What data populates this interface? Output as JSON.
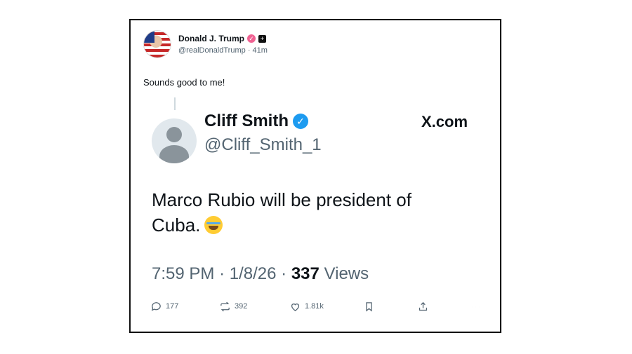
{
  "post": {
    "display_name": "Donald J. Trump",
    "handle": "@realDonaldTrump",
    "time": "41m",
    "text": "Sounds good to me!"
  },
  "quoted": {
    "display_name": "Cliff Smith",
    "handle": "@Cliff_Smith_1",
    "source": "X.com",
    "text": "Marco Rubio will be president of Cuba.",
    "time": "7:59 PM",
    "date": "1/8/26",
    "views_count": "337",
    "views_label": "Views"
  },
  "actions": {
    "replies": "177",
    "reposts": "392",
    "likes": "1.81k"
  },
  "colors": {
    "verified": "#1d9bf0",
    "secondary_text": "#536471",
    "badge_pink": "#f06292"
  }
}
